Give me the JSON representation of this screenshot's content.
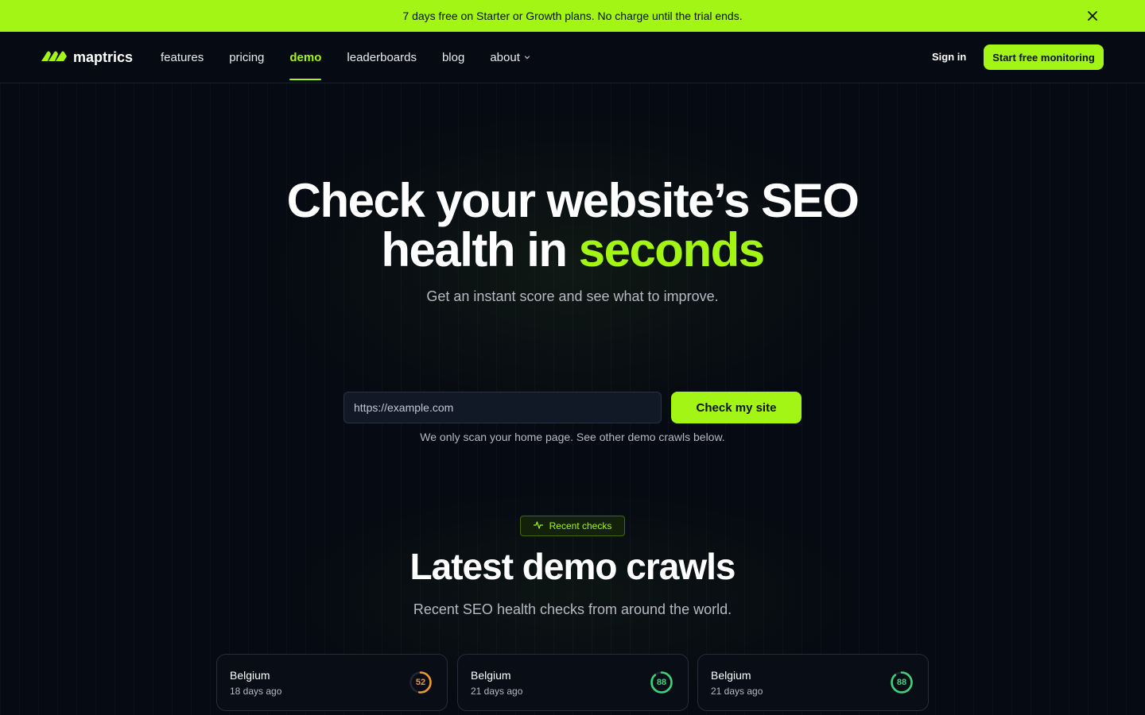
{
  "announcement": {
    "text": "7 days free on Starter or Growth plans. No charge until the trial ends."
  },
  "header": {
    "brand": "maptrics",
    "nav": [
      {
        "label": "features",
        "active": false
      },
      {
        "label": "pricing",
        "active": false
      },
      {
        "label": "demo",
        "active": true
      },
      {
        "label": "leaderboards",
        "active": false
      },
      {
        "label": "blog",
        "active": false
      },
      {
        "label": "about",
        "active": false,
        "dropdown": true
      }
    ],
    "sign_in": "Sign in",
    "cta": "Start free monitoring"
  },
  "hero": {
    "title_line1": "Check your website’s SEO",
    "title_line2_prefix": "health in ",
    "title_line2_accent": "seconds",
    "subtitle": "Get an instant score and see what to improve.",
    "url_placeholder": "https://example.com",
    "url_value": "",
    "check_button": "Check my site",
    "note": "We only scan your home page. See other demo crawls below."
  },
  "recent": {
    "badge": "Recent checks",
    "title": "Latest demo crawls",
    "subtitle": "Recent SEO health checks from around the world.",
    "cards": [
      {
        "country": "Belgium",
        "ago": "18 days ago",
        "score": 52,
        "color": "#f0963a"
      },
      {
        "country": "Belgium",
        "ago": "21 days ago",
        "score": 88,
        "color": "#3ed37a"
      },
      {
        "country": "Belgium",
        "ago": "21 days ago",
        "score": 88,
        "color": "#3ed37a"
      }
    ]
  },
  "colors": {
    "accent": "#a3f515",
    "background": "#060a12",
    "score_medium": "#f0963a",
    "score_good": "#3ed37a"
  }
}
